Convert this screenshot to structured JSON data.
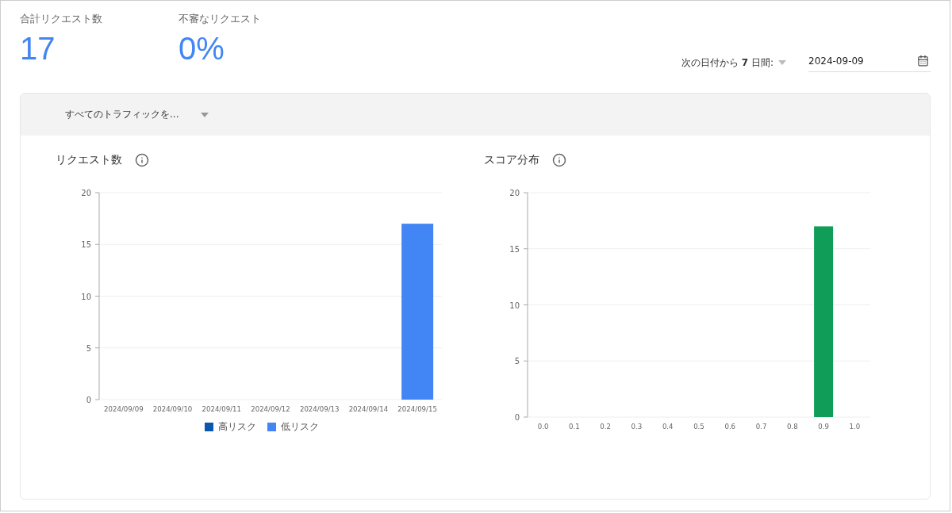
{
  "stats": [
    {
      "label": "合計リクエスト数",
      "value": "17"
    },
    {
      "label": "不審なリクエスト",
      "value": "0%"
    }
  ],
  "range": {
    "label": "次の日付から **7** 日間:",
    "date": "2024-09-09"
  },
  "filter": {
    "label": "すべてのトラフィックを..."
  },
  "panels": [
    {
      "title": "リクエスト数",
      "chart_data": {
        "type": "bar",
        "grid": true,
        "categories": [
          "2024/09/09",
          "2024/09/10",
          "2024/09/11",
          "2024/09/12",
          "2024/09/13",
          "2024/09/14",
          "2024/09/15"
        ],
        "ylim": [
          0,
          20
        ],
        "yticks": [
          0,
          5,
          10,
          15,
          20
        ],
        "series": [
          {
            "name": "高リスク",
            "color": "#0b57b0",
            "values": [
              0,
              0,
              0,
              0,
              0,
              0,
              0
            ]
          },
          {
            "name": "低リスク",
            "color": "#4285f4",
            "values": [
              0,
              0,
              0,
              0,
              0,
              0,
              17
            ]
          }
        ]
      }
    },
    {
      "title": "スコア分布",
      "chart_data": {
        "type": "bar",
        "grid": true,
        "categories": [
          "0.0",
          "0.1",
          "0.2",
          "0.3",
          "0.4",
          "0.5",
          "0.6",
          "0.7",
          "0.8",
          "0.9",
          "1.0"
        ],
        "ylim": [
          0,
          20
        ],
        "yticks": [
          0,
          5,
          10,
          15,
          20
        ],
        "series": [
          {
            "color": "#0f9d58",
            "values": [
              0,
              0,
              0,
              0,
              0,
              0,
              0,
              0,
              0,
              17,
              0
            ]
          }
        ]
      }
    }
  ]
}
